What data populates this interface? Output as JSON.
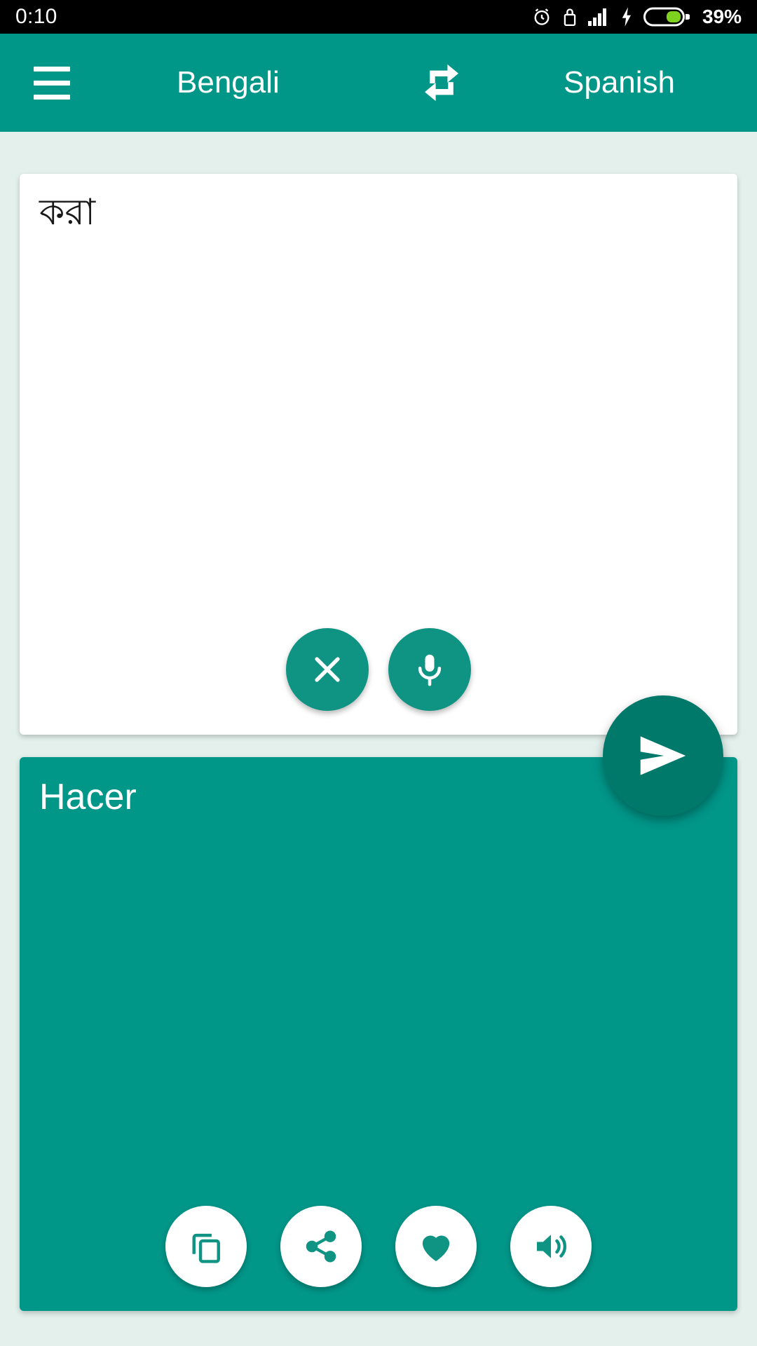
{
  "status_bar": {
    "time": "0:10",
    "battery_percent": "39%",
    "icons": [
      "alarm-icon",
      "lock-icon",
      "signal-bars-icon",
      "charging-bolt-icon",
      "battery-icon"
    ]
  },
  "toolbar": {
    "menu_icon": "hamburger-menu-icon",
    "source_language": "Bengali",
    "target_language": "Spanish",
    "swap_icon": "swap-languages-icon",
    "background_color": "#009688",
    "text_color": "#ffffff"
  },
  "source_card": {
    "text": "করা",
    "placeholder": "",
    "background_color": "#ffffff",
    "actions": [
      {
        "name": "clear-button",
        "icon": "close-icon"
      },
      {
        "name": "mic-button",
        "icon": "microphone-icon"
      }
    ]
  },
  "send_button": {
    "icon": "send-icon",
    "color": "#00796b"
  },
  "result_card": {
    "text": "Hacer",
    "background_color": "#009688",
    "text_color": "#ffffff",
    "actions": [
      {
        "name": "copy-button",
        "icon": "copy-icon"
      },
      {
        "name": "share-button",
        "icon": "share-icon"
      },
      {
        "name": "favorite-button",
        "icon": "heart-icon"
      },
      {
        "name": "speak-button",
        "icon": "speaker-icon"
      }
    ]
  },
  "page": {
    "background_color": "#e3f0ec"
  }
}
